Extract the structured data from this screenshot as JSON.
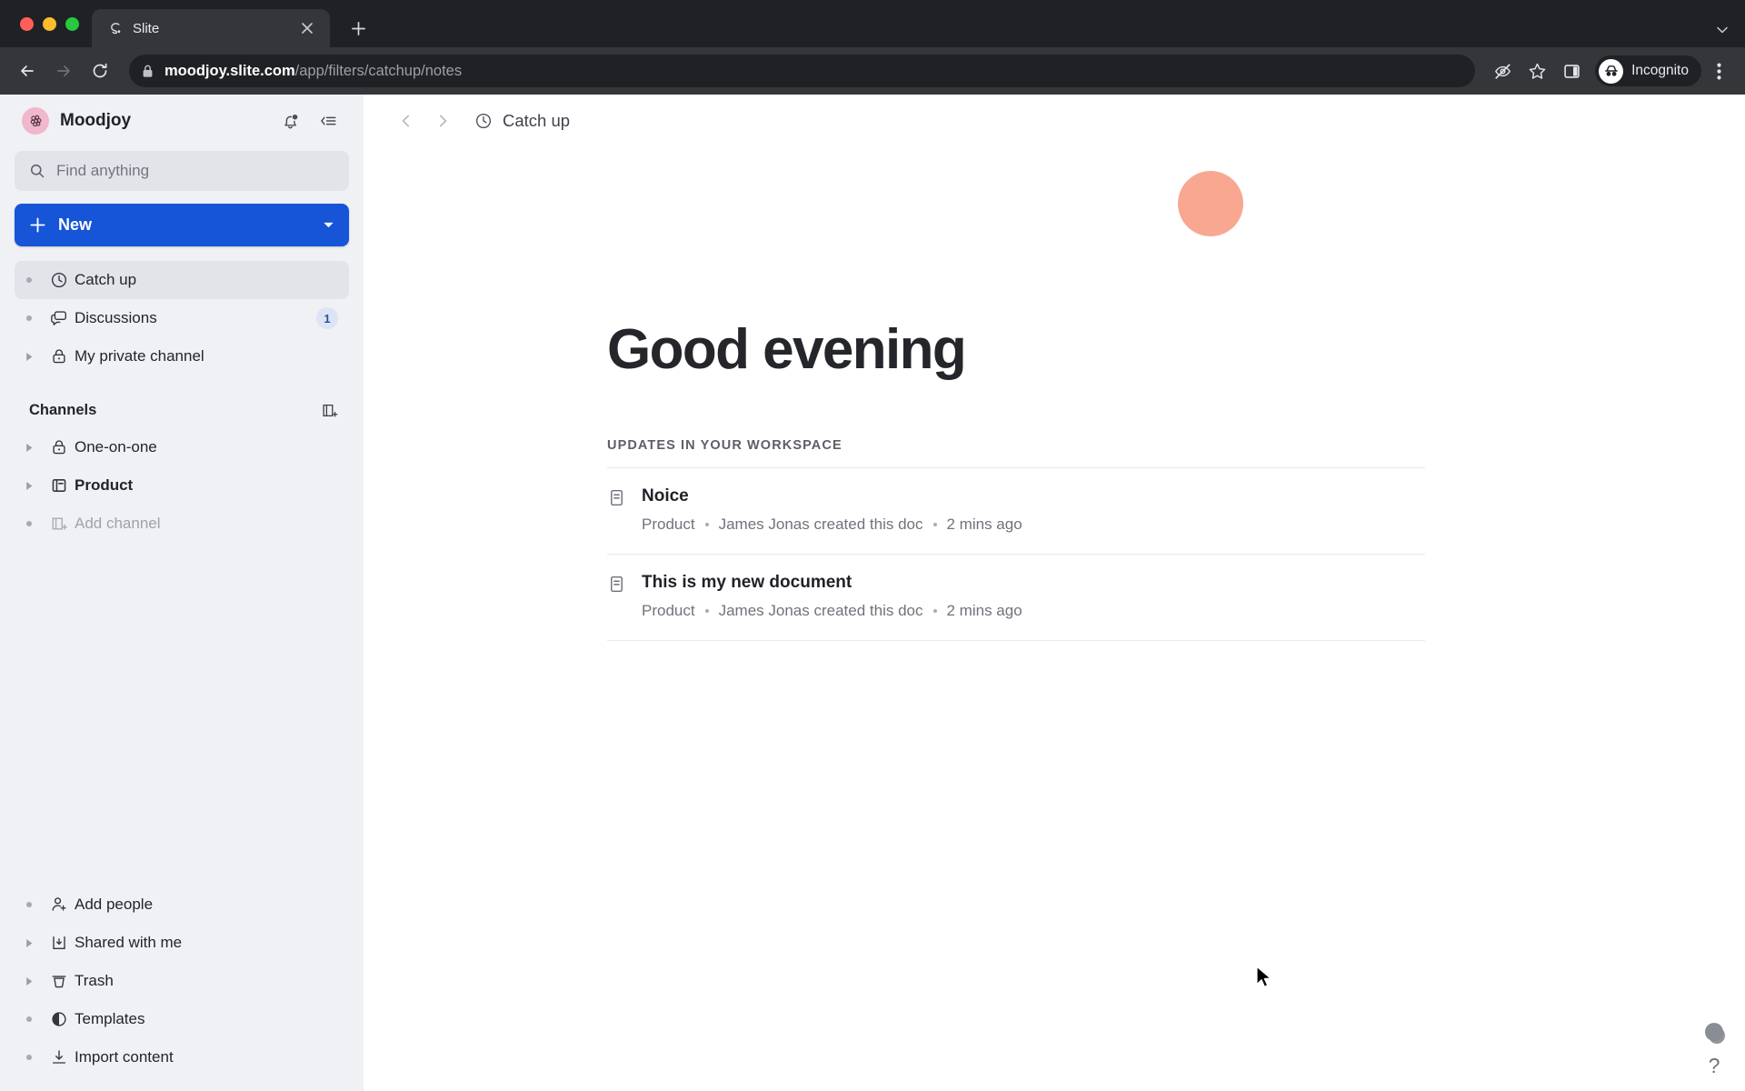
{
  "browser": {
    "tab": {
      "title": "Slite",
      "favicon": "slite-logo-icon",
      "close_icon": "close-icon"
    },
    "new_tab_icon": "plus-icon",
    "tabstrip_menu_icon": "chevron-down-icon",
    "back_icon": "back-arrow-icon",
    "forward_icon": "forward-arrow-icon",
    "reload_icon": "reload-icon",
    "lock_icon": "lock-icon",
    "url_host": "moodjoy.slite.com",
    "url_path": "/app/filters/catchup/notes",
    "tracking_icon": "eye-slash-icon",
    "bookmark_icon": "star-icon",
    "sidepanel_icon": "side-panel-icon",
    "profile_label": "Incognito",
    "profile_icon": "incognito-icon",
    "menu_icon": "three-dot-menu-icon"
  },
  "sidebar": {
    "workspace_name": "Moodjoy",
    "workspace_logo": "moodjoy-berry-logo",
    "notifications_icon": "bell-icon",
    "collapse_icon": "collapse-sidebar-icon",
    "search": {
      "placeholder": "Find anything",
      "icon": "search-icon"
    },
    "new_button": {
      "label": "New",
      "plus_icon": "plus-icon",
      "caret_icon": "chevron-down-icon"
    },
    "nav": [
      {
        "label": "Catch up",
        "icon": "clock-icon",
        "marker": "bullet",
        "active": true,
        "badge": ""
      },
      {
        "label": "Discussions",
        "icon": "chat-bubble-icon",
        "marker": "bullet",
        "active": false,
        "badge": "1"
      },
      {
        "label": "My private channel",
        "icon": "lock-icon",
        "marker": "triangle",
        "active": false,
        "badge": ""
      }
    ],
    "channels_section": {
      "title": "Channels",
      "add_icon": "add-channel-icon",
      "items": [
        {
          "label": "One-on-one",
          "icon": "lock-icon",
          "marker": "triangle",
          "bold": false,
          "muted": false
        },
        {
          "label": "Product",
          "icon": "channel-icon",
          "marker": "triangle",
          "bold": true,
          "muted": false
        },
        {
          "label": "Add channel",
          "icon": "add-channel-icon",
          "marker": "bullet",
          "bold": false,
          "muted": true
        }
      ]
    },
    "bottom_nav": [
      {
        "label": "Add people",
        "icon": "add-person-icon",
        "marker": "bullet"
      },
      {
        "label": "Shared with me",
        "icon": "inbox-download-icon",
        "marker": "triangle"
      },
      {
        "label": "Trash",
        "icon": "trash-icon",
        "marker": "triangle"
      },
      {
        "label": "Templates",
        "icon": "templates-circle-icon",
        "marker": "bullet"
      },
      {
        "label": "Import content",
        "icon": "download-icon",
        "marker": "bullet"
      }
    ]
  },
  "main": {
    "back_icon": "chevron-left-icon",
    "forward_icon": "chevron-right-icon",
    "breadcrumb": {
      "label": "Catch up",
      "icon": "clock-icon"
    },
    "greeting": "Good evening",
    "decoration_color": "#f8a791",
    "updates_heading": "UPDATES IN YOUR WORKSPACE",
    "updates": [
      {
        "title": "Noice",
        "icon": "document-icon",
        "channel": "Product",
        "action": "James Jonas created this doc",
        "time": "2 mins ago"
      },
      {
        "title": "This is my new document",
        "icon": "document-icon",
        "channel": "Product",
        "action": "James Jonas created this doc",
        "time": "2 mins ago"
      }
    ],
    "help": {
      "icon": "help-question-icon",
      "label": "?"
    }
  }
}
